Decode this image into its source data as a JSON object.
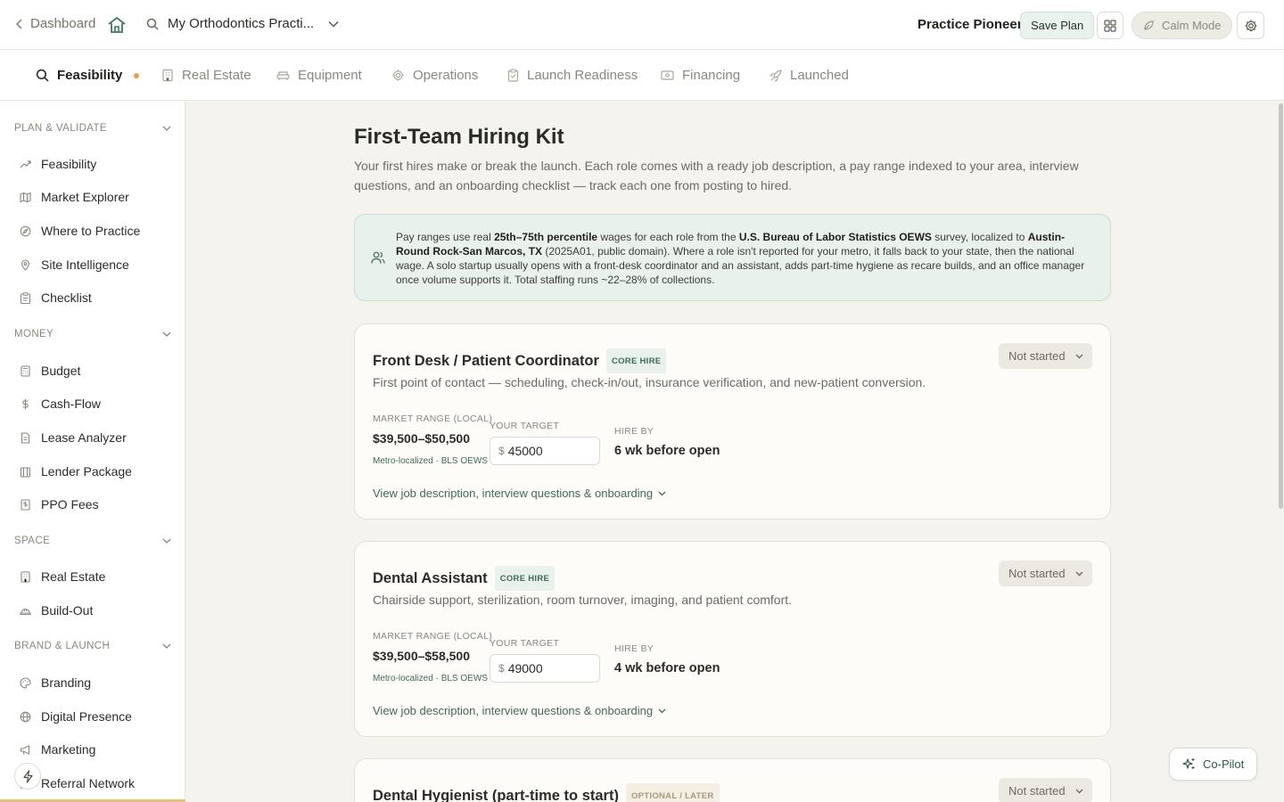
{
  "topbar": {
    "back_label": "Dashboard",
    "practice_name": "My Orthodontics Practi...",
    "brand": "Practice Pioneer",
    "save_label": "Save Plan",
    "calm_label": "Calm Mode"
  },
  "tabs": [
    {
      "label": "Feasibility",
      "icon": "search-icon",
      "active": true
    },
    {
      "label": "Real Estate",
      "icon": "building-icon"
    },
    {
      "label": "Equipment",
      "icon": "couch-icon"
    },
    {
      "label": "Operations",
      "icon": "gear-icon"
    },
    {
      "label": "Launch Readiness",
      "icon": "clipboard-icon"
    },
    {
      "label": "Financing",
      "icon": "banknote-icon"
    },
    {
      "label": "Launched",
      "icon": "rocket-icon"
    }
  ],
  "sidebar": {
    "sections": [
      {
        "title": "PLAN & VALIDATE",
        "items": [
          {
            "label": "Feasibility",
            "icon": "trend-icon"
          },
          {
            "label": "Market Explorer",
            "icon": "map-icon"
          },
          {
            "label": "Where to Practice",
            "icon": "compass-icon"
          },
          {
            "label": "Site Intelligence",
            "icon": "pin-icon"
          },
          {
            "label": "Checklist",
            "icon": "clipboard-icon"
          }
        ]
      },
      {
        "title": "MONEY",
        "items": [
          {
            "label": "Budget",
            "icon": "calculator-icon"
          },
          {
            "label": "Cash-Flow",
            "icon": "dollar-icon"
          },
          {
            "label": "Lease Analyzer",
            "icon": "document-icon"
          },
          {
            "label": "Lender Package",
            "icon": "bank-icon"
          },
          {
            "label": "PPO Fees",
            "icon": "receipt-icon"
          }
        ]
      },
      {
        "title": "SPACE",
        "items": [
          {
            "label": "Real Estate",
            "icon": "building-icon"
          },
          {
            "label": "Build-Out",
            "icon": "hardhat-icon"
          }
        ]
      },
      {
        "title": "BRAND & LAUNCH",
        "items": [
          {
            "label": "Branding",
            "icon": "palette-icon"
          },
          {
            "label": "Digital Presence",
            "icon": "globe-icon"
          },
          {
            "label": "Marketing",
            "icon": "megaphone-icon"
          },
          {
            "label": "Referral Network",
            "icon": "network-icon"
          }
        ]
      }
    ]
  },
  "main": {
    "title": "First-Team Hiring Kit",
    "subtitle": "Your first hires make or break the launch. Each role comes with a ready job description, a pay range indexed to your area, interview questions, and an onboarding checklist — track each one from posting to hired.",
    "info": {
      "p1": "Pay ranges use real ",
      "b1": "25th–75th percentile",
      "p2": " wages for each role from the ",
      "b2": "U.S. Bureau of Labor Statistics OEWS",
      "p3": " survey, localized to ",
      "b3": "Austin-Round Rock-San Marcos, TX",
      "p4": " (2025A01, public domain). Where a role isn't reported for your metro, it falls back to your state, then the national wage. A solo startup usually opens with a front-desk coordinator and an assistant, adds part-time hygiene as recare builds, and an office manager once volume supports it. Total staffing runs ~22–28% of collections."
    },
    "labels": {
      "market_range": "MARKET RANGE (LOCAL)",
      "your_target": "YOUR TARGET",
      "hire_by": "HIRE BY",
      "source": "Metro-localized · BLS OEWS",
      "view_link": "View job description, interview questions & onboarding",
      "currency": "$"
    },
    "roles": [
      {
        "title": "Front Desk / Patient Coordinator",
        "badge": "CORE HIRE",
        "status": "Not started",
        "desc": "First point of contact — scheduling, check-in/out, insurance verification, and new-patient conversion.",
        "range": "$39,500–$50,500",
        "target": "45000",
        "hire_by": "6 wk before open"
      },
      {
        "title": "Dental Assistant",
        "badge": "CORE HIRE",
        "status": "Not started",
        "desc": "Chairside support, sterilization, room turnover, imaging, and patient comfort.",
        "range": "$39,500–$58,500",
        "target": "49000",
        "hire_by": "4 wk before open"
      },
      {
        "title": "Dental Hygienist (part-time to start)",
        "badge": "OPTIONAL / LATER",
        "status": "Not started"
      }
    ]
  },
  "copilot_label": "Co-Pilot"
}
